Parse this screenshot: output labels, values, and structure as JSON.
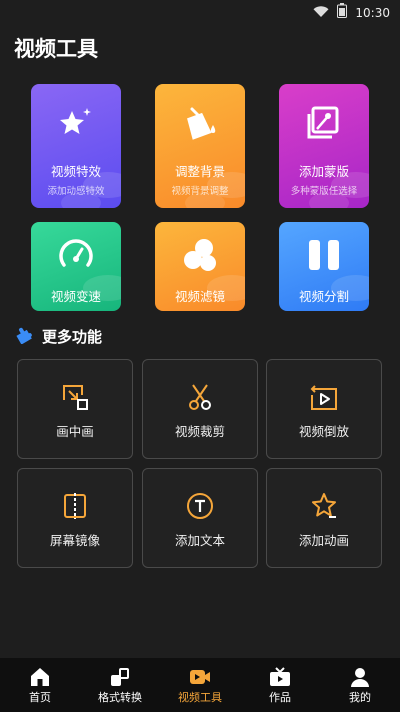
{
  "status_bar": {
    "time": "10:30"
  },
  "page_title": "视频工具",
  "tools": [
    {
      "title": "视频特效",
      "subtitle": "添加动感特效",
      "icon": "magic-star-icon"
    },
    {
      "title": "调整背景",
      "subtitle": "视频背景调整",
      "icon": "paint-bucket-icon"
    },
    {
      "title": "添加蒙版",
      "subtitle": "多种蒙版任选择",
      "icon": "mask-layers-icon"
    },
    {
      "title": "视频变速",
      "subtitle": "",
      "icon": "speedometer-icon"
    },
    {
      "title": "视频滤镜",
      "subtitle": "",
      "icon": "filter-circles-icon"
    },
    {
      "title": "视频分割",
      "subtitle": "",
      "icon": "split-bars-icon"
    }
  ],
  "more_section": {
    "title": "更多功能",
    "icon": "puzzle-icon"
  },
  "more_tools": [
    {
      "label": "画中画",
      "icon": "picture-in-picture-icon"
    },
    {
      "label": "视频裁剪",
      "icon": "scissors-icon"
    },
    {
      "label": "视频倒放",
      "icon": "reverse-play-icon"
    },
    {
      "label": "屏幕镜像",
      "icon": "mirror-icon"
    },
    {
      "label": "添加文本",
      "icon": "text-circle-icon"
    },
    {
      "label": "添加动画",
      "icon": "animation-star-icon"
    }
  ],
  "bottom_nav": [
    {
      "label": "首页",
      "icon": "home-icon",
      "active": false
    },
    {
      "label": "格式转换",
      "icon": "convert-icon",
      "active": false
    },
    {
      "label": "视频工具",
      "icon": "video-tool-icon",
      "active": true
    },
    {
      "label": "作品",
      "icon": "tv-icon",
      "active": false
    },
    {
      "label": "我的",
      "icon": "profile-icon",
      "active": false
    }
  ],
  "colors": {
    "accent": "#f5a63a",
    "card_purple": [
      "#8a67f4",
      "#5b4cf0"
    ],
    "card_orange": [
      "#fcb63c",
      "#f98a2a"
    ],
    "card_magenta": [
      "#d93ec9",
      "#a726c8"
    ],
    "card_green": [
      "#37d99a",
      "#17b57c"
    ],
    "card_blue": [
      "#55a6ff",
      "#2f7bf5"
    ]
  }
}
